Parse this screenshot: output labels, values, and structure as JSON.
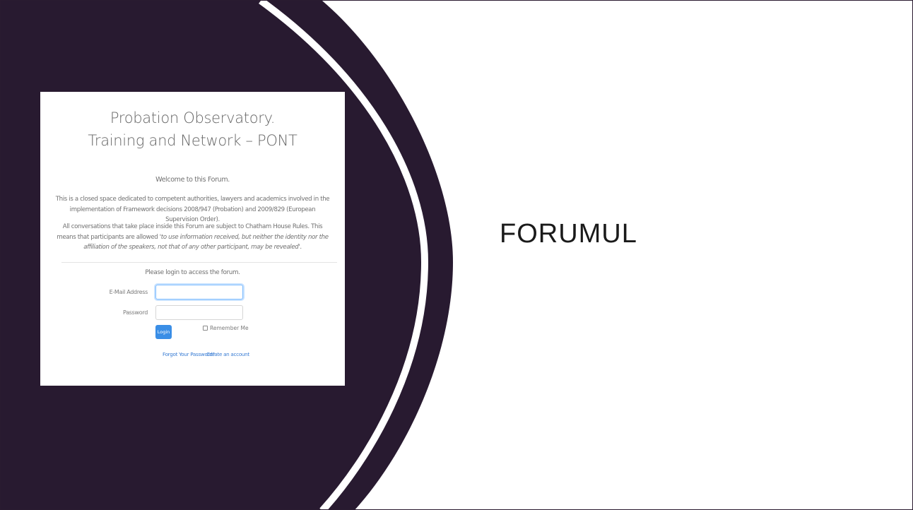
{
  "colors": {
    "background": "#ffffff",
    "dark_shape": "#281a30",
    "accent_arc": "#ffffff",
    "login_button": "#3a8ee6",
    "link": "#3a7dd4"
  },
  "login_panel": {
    "title_line1": "Probation Observatory.",
    "title_line2": "Training and Network – PONT",
    "welcome": "Welcome to this Forum.",
    "intro": "This is a closed space dedicated to competent authorities, lawyers and academics involved in the implementation of Framework decisions 2008/947 (Probation) and 2009/829 (European Supervision Order).",
    "rules_lead": "All conversations that take place inside this Forum are subject to Chatham House Rules. This means that participants are allowed ",
    "rules_quote": "'to use information received, but neither the identity nor the affiliation of the speakers, not that of any other participant, may be revealed'",
    "rules_end": ".",
    "login_prompt": "Please login to access the forum.",
    "email_label": "E-Mail Address",
    "email_value": "",
    "password_label": "Password",
    "password_value": "",
    "login_button": "Login",
    "remember_me": "Remember Me",
    "forgot_password": "Forgot Your Password?",
    "create_account": "Create an account"
  },
  "slide": {
    "title": "FORUMUL"
  }
}
